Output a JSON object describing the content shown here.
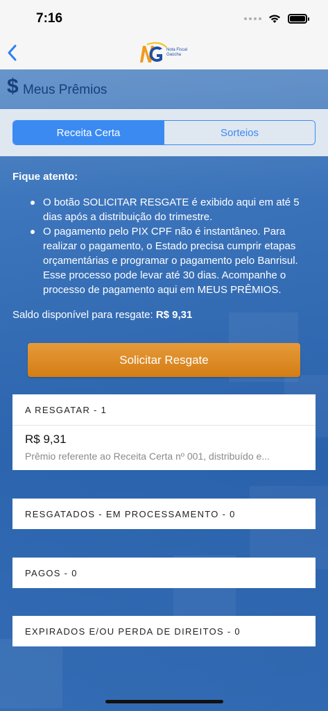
{
  "status_bar": {
    "time": "7:16"
  },
  "nav": {
    "logo_text_1": "Nota Fiscal",
    "logo_text_2": "Gaúcha"
  },
  "header": {
    "title": "Meus Prêmios",
    "dollar_symbol": "$"
  },
  "tabs": [
    {
      "label": "Receita Certa",
      "active": true
    },
    {
      "label": "Sorteios",
      "active": false
    }
  ],
  "notice": {
    "title": "Fique atento:",
    "bullets": [
      "O botão SOLICITAR RESGATE é exibido aqui em até 5 dias após a distribuição do trimestre.",
      "O pagamento pelo PIX CPF não é instantâneo. Para realizar o pagamento, o Estado precisa cumprir etapas orçamentárias e programar o pagamento pelo Banrisul. Esse processo pode levar até 30 dias. Acompanhe o processo de pagamento aqui em MEUS PRÊMIOS."
    ],
    "balance_label": "Saldo disponível para resgate:",
    "balance_value": "R$ 9,31"
  },
  "redeem_button": {
    "label": "Solicitar Resgate"
  },
  "sections": {
    "to_redeem": {
      "header": "A RESGATAR - 1",
      "items": [
        {
          "value": "R$ 9,31",
          "description": "Prêmio referente ao Receita Certa nº 001, distribuído e..."
        }
      ]
    },
    "processing": {
      "header": "RESGATADOS - EM PROCESSAMENTO - 0"
    },
    "paid": {
      "header": "PAGOS - 0"
    },
    "expired": {
      "header": "EXPIRADOS E/OU PERDA DE DIREITOS - 0"
    }
  },
  "colors": {
    "accent": "#3a8af2",
    "button_orange": "#d88520",
    "title_blue": "#173f7a",
    "background_blue": "#2f68b0"
  }
}
